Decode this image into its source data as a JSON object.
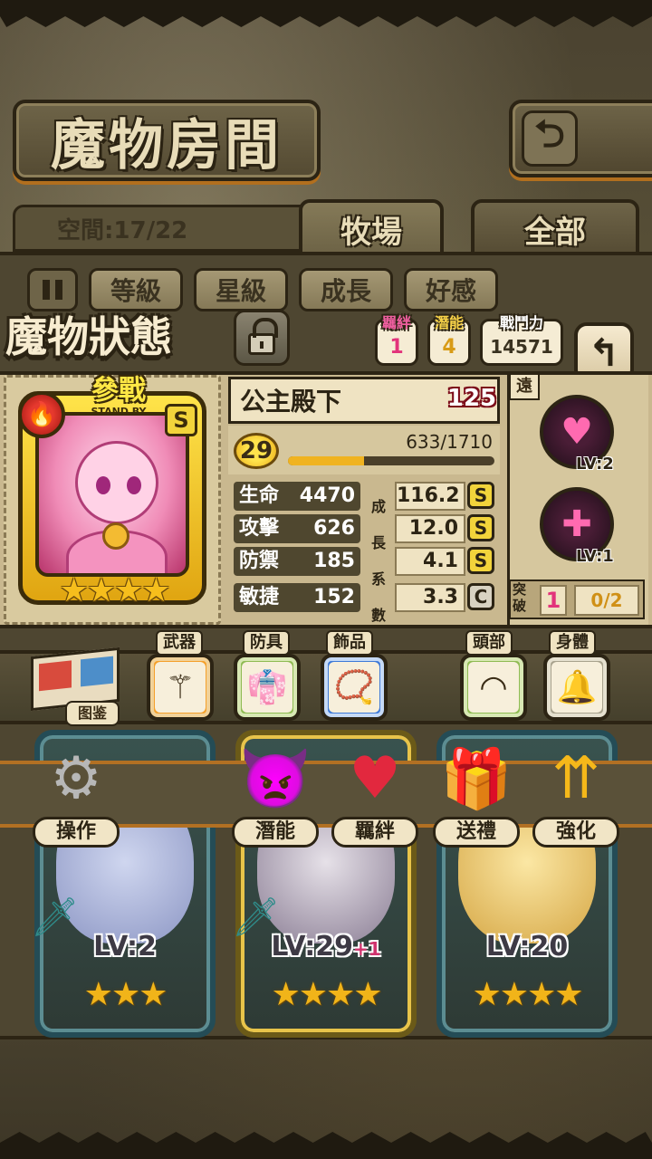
{
  "header": {
    "title": "魔物房間",
    "space_label": "空間:17/22"
  },
  "tabs": [
    {
      "label": "牧場",
      "active": true
    },
    {
      "label": "全部",
      "active": false
    }
  ],
  "sort_buttons": [
    "等級",
    "星級",
    "成長",
    "好感"
  ],
  "status": {
    "title": "魔物狀態",
    "bond_label": "羈絆",
    "bond_value": "1",
    "potential_label": "潛能",
    "potential_value": "4",
    "power_label": "戰鬥力",
    "power_value": "14571"
  },
  "monster": {
    "standby_main": "參戰",
    "standby_sub": "STAND BY",
    "rank": "S",
    "stars": "★★★★",
    "name": "公主殿下",
    "heart_value": "125",
    "level": "29",
    "exp_text": "633/1710",
    "exp_ratio": 0.37,
    "stats": [
      {
        "label": "生命",
        "value": "4470",
        "growth": "116.2",
        "grade": "S"
      },
      {
        "label": "攻擊",
        "value": "626",
        "growth": "12.0",
        "grade": "S"
      },
      {
        "label": "防禦",
        "value": "185",
        "growth": "4.1",
        "grade": "S"
      },
      {
        "label": "敏捷",
        "value": "152",
        "growth": "3.3",
        "grade": "C"
      }
    ],
    "growth_vertical": [
      "成",
      "長",
      "系",
      "數"
    ]
  },
  "skills": {
    "range": "遠",
    "items": [
      {
        "lv": "LV:2",
        "icon": "heart-dash-icon"
      },
      {
        "lv": "LV:1",
        "icon": "sparkle-cross-icon"
      }
    ],
    "break_label": "突破",
    "break_value": "1",
    "break_progress": "0/2"
  },
  "equipment": {
    "book_label": "图鉴",
    "slots": [
      {
        "label": "武器",
        "icon": "staff-icon"
      },
      {
        "label": "防具",
        "icon": "uniform-icon"
      },
      {
        "label": "飾品",
        "icon": "necklace-icon"
      },
      {
        "label": "頭部",
        "icon": "headband-icon"
      },
      {
        "label": "身體",
        "icon": "collar-icon"
      }
    ]
  },
  "actions": [
    {
      "label": "操作",
      "icon": "gear-icon"
    },
    {
      "label": "潛能",
      "icon": "demon-icon"
    },
    {
      "label": "羈絆",
      "icon": "hearts-icon"
    },
    {
      "label": "送禮",
      "icon": "gift-icon"
    },
    {
      "label": "強化",
      "icon": "arrows-up-icon"
    }
  ],
  "cards": [
    {
      "lv": "LV:2",
      "plus": "",
      "stars": "★★★"
    },
    {
      "lv": "LV:29",
      "plus": "+1",
      "stars": "★★★★"
    },
    {
      "lv": "LV:20",
      "plus": "",
      "stars": "★★★★"
    }
  ]
}
